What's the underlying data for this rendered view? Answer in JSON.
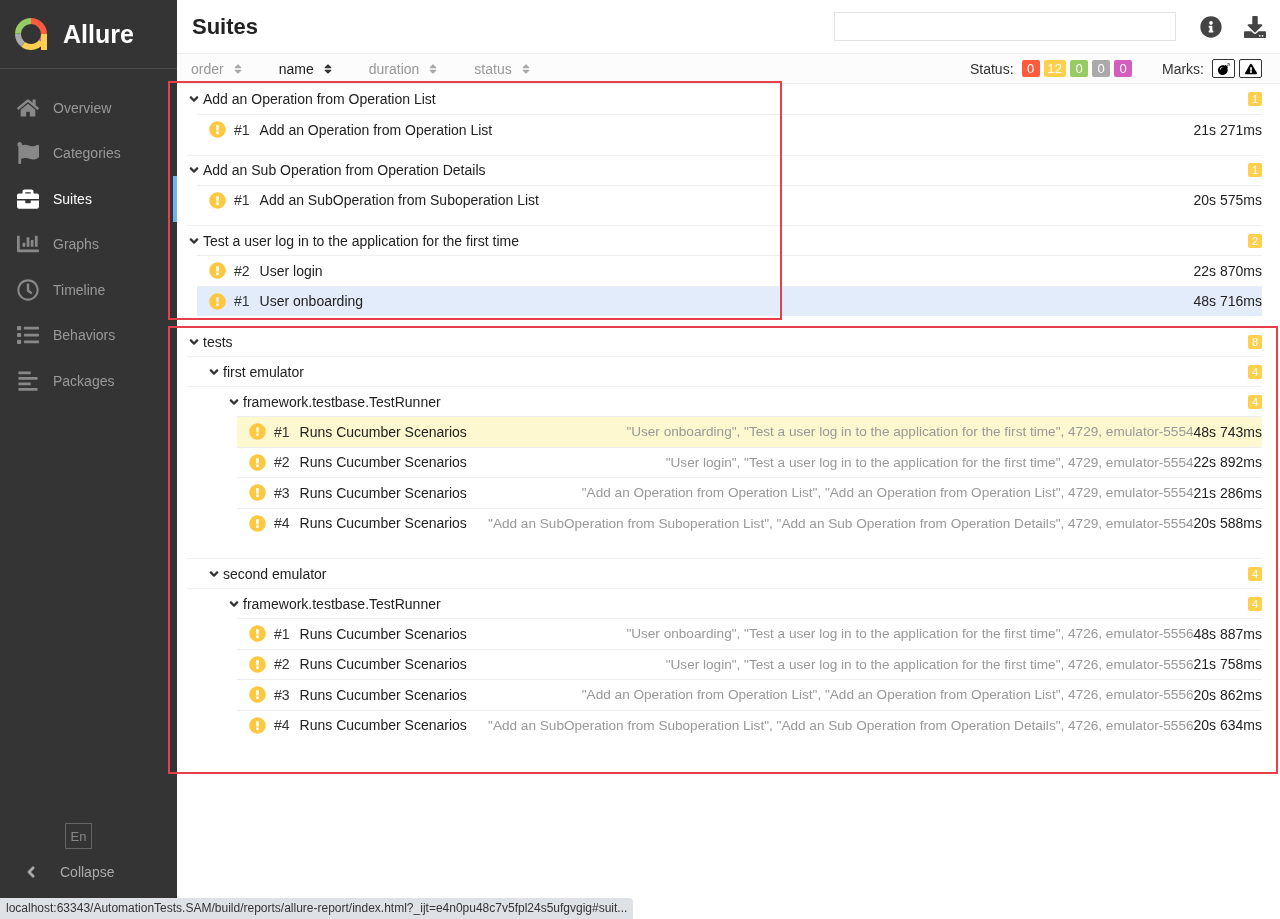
{
  "sidebar": {
    "logo": "Allure",
    "items": [
      {
        "label": "Overview",
        "selected": false
      },
      {
        "label": "Categories",
        "selected": false
      },
      {
        "label": "Suites",
        "selected": true
      },
      {
        "label": "Graphs",
        "selected": false
      },
      {
        "label": "Timeline",
        "selected": false
      },
      {
        "label": "Behaviors",
        "selected": false
      },
      {
        "label": "Packages",
        "selected": false
      }
    ],
    "language": "En",
    "collapse": "Collapse"
  },
  "header": {
    "title": "Suites"
  },
  "sort_columns": [
    {
      "label": "order",
      "selected": false
    },
    {
      "label": "name",
      "selected": true
    },
    {
      "label": "duration",
      "selected": false
    },
    {
      "label": "status",
      "selected": false
    }
  ],
  "status_filter": {
    "label": "Status:",
    "counts": [
      {
        "value": "0",
        "color": "#fd5a3e"
      },
      {
        "value": "12",
        "color": "#ffd050"
      },
      {
        "value": "0",
        "color": "#97cc64"
      },
      {
        "value": "0",
        "color": "#aaaaaa"
      },
      {
        "value": "0",
        "color": "#d35ebe"
      }
    ]
  },
  "marks": {
    "label": "Marks:"
  },
  "tree": [
    {
      "kind": "group",
      "label": "Add an Operation from Operation List",
      "count": "1",
      "expanded": true,
      "children": [
        {
          "kind": "test",
          "order": "#1",
          "name": "Add an Operation from Operation List",
          "duration": "21s 271ms",
          "selected": false,
          "hovered": false
        }
      ]
    },
    {
      "kind": "group",
      "label": "Add an Sub Operation from Operation Details",
      "count": "1",
      "expanded": true,
      "children": [
        {
          "kind": "test",
          "order": "#1",
          "name": "Add an SubOperation from Suboperation List",
          "duration": "20s 575ms",
          "selected": false,
          "hovered": false
        }
      ]
    },
    {
      "kind": "group",
      "label": "Test a user log in to the application for the first time",
      "count": "2",
      "expanded": true,
      "children": [
        {
          "kind": "test",
          "order": "#2",
          "name": "User login",
          "duration": "22s 870ms",
          "selected": false,
          "hovered": false
        },
        {
          "kind": "test",
          "order": "#1",
          "name": "User onboarding",
          "duration": "48s 716ms",
          "selected": true,
          "hovered": false
        }
      ]
    },
    {
      "kind": "group",
      "label": "tests",
      "count": "8",
      "expanded": true,
      "children": [
        {
          "kind": "group",
          "label": "first emulator",
          "count": "4",
          "expanded": true,
          "children": [
            {
              "kind": "group",
              "label": "framework.testbase.TestRunner",
              "count": "4",
              "expanded": true,
              "children": [
                {
                  "kind": "test",
                  "order": "#1",
                  "name": "Runs Cucumber Scenarios",
                  "params": "\"User onboarding\", \"Test a user log in to the application for the first time\", 4729, emulator-5554",
                  "duration": "48s 743ms",
                  "selected": false,
                  "hovered": true
                },
                {
                  "kind": "test",
                  "order": "#2",
                  "name": "Runs Cucumber Scenarios",
                  "params": "\"User login\", \"Test a user log in to the application for the first time\", 4729, emulator-5554",
                  "duration": "22s 892ms",
                  "selected": false,
                  "hovered": false
                },
                {
                  "kind": "test",
                  "order": "#3",
                  "name": "Runs Cucumber Scenarios",
                  "params": "\"Add an Operation from Operation List\", \"Add an Operation from Operation List\", 4729, emulator-5554",
                  "duration": "21s 286ms",
                  "selected": false,
                  "hovered": false
                },
                {
                  "kind": "test",
                  "order": "#4",
                  "name": "Runs Cucumber Scenarios",
                  "params": "\"Add an SubOperation from Suboperation List\", \"Add an Sub Operation from Operation Details\", 4729, emulator-5554",
                  "duration": "20s 588ms",
                  "selected": false,
                  "hovered": false
                }
              ]
            }
          ]
        },
        {
          "kind": "group",
          "label": "second emulator",
          "count": "4",
          "expanded": true,
          "children": [
            {
              "kind": "group",
              "label": "framework.testbase.TestRunner",
              "count": "4",
              "expanded": true,
              "children": [
                {
                  "kind": "test",
                  "order": "#1",
                  "name": "Runs Cucumber Scenarios",
                  "params": "\"User onboarding\", \"Test a user log in to the application for the first time\", 4726, emulator-5556",
                  "duration": "48s 887ms",
                  "selected": false,
                  "hovered": false
                },
                {
                  "kind": "test",
                  "order": "#2",
                  "name": "Runs Cucumber Scenarios",
                  "params": "\"User login\", \"Test a user log in to the application for the first time\", 4726, emulator-5556",
                  "duration": "21s 758ms",
                  "selected": false,
                  "hovered": false
                },
                {
                  "kind": "test",
                  "order": "#3",
                  "name": "Runs Cucumber Scenarios",
                  "params": "\"Add an Operation from Operation List\", \"Add an Operation from Operation List\", 4726, emulator-5556",
                  "duration": "20s 862ms",
                  "selected": false,
                  "hovered": false
                },
                {
                  "kind": "test",
                  "order": "#4",
                  "name": "Runs Cucumber Scenarios",
                  "params": "\"Add an SubOperation from Suboperation List\", \"Add an Sub Operation from Operation Details\", 4726, emulator-5556",
                  "duration": "20s 634ms",
                  "selected": false,
                  "hovered": false
                }
              ]
            }
          ]
        }
      ]
    }
  ],
  "status_bar": "localhost:63343/AutomationTests.SAM/build/reports/allure-report/index.html?_ijt=e4n0pu48c7v5fpl24s5ufgvgig#suit..."
}
